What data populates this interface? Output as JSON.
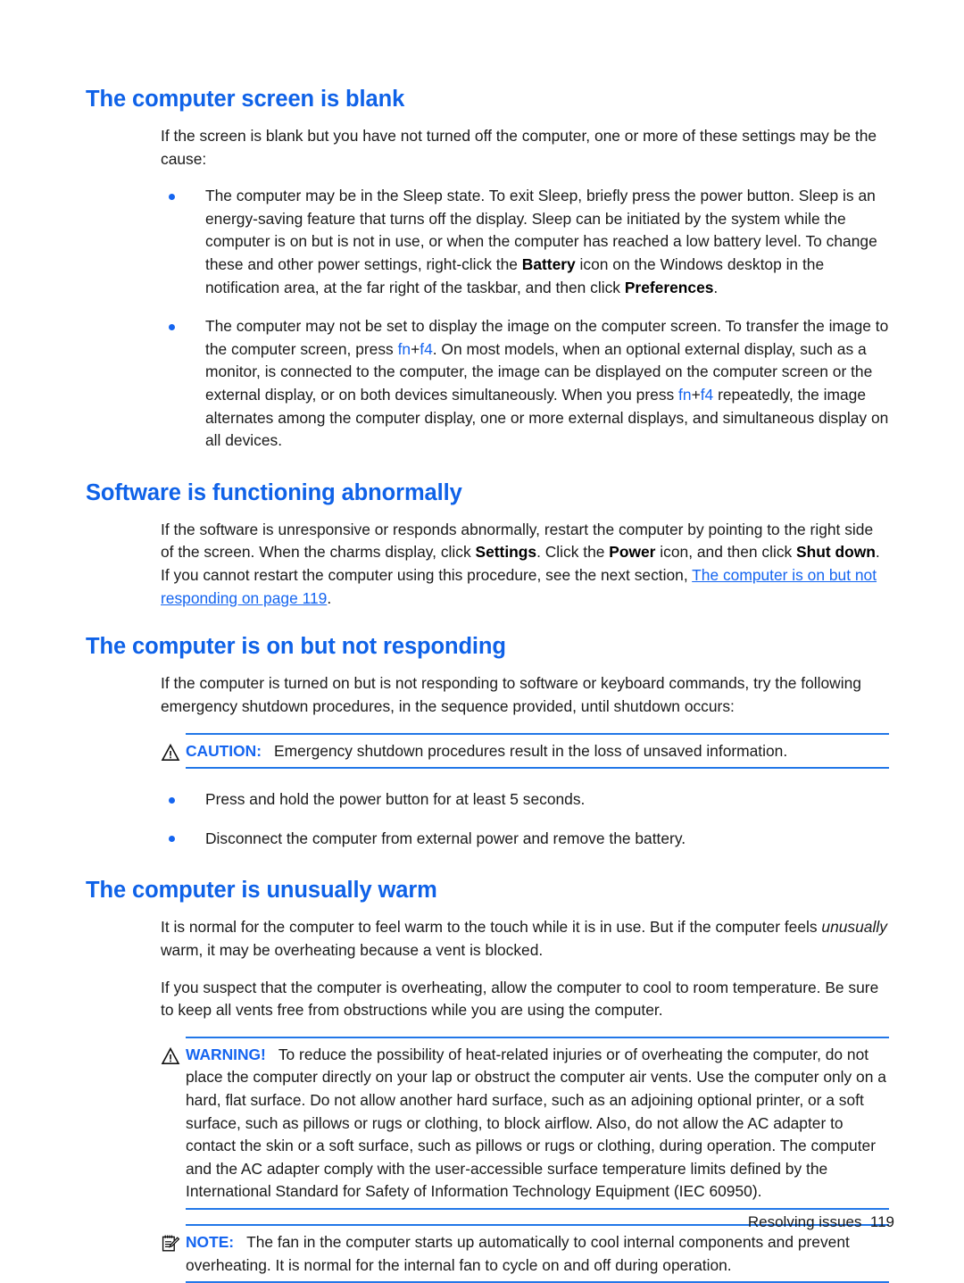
{
  "document": {
    "footer_text": "Resolving issues",
    "footer_page": "119",
    "accent_blue": "#1565f0",
    "rule_blue": "#2277e8"
  },
  "sections": [
    {
      "id": "screen-blank",
      "heading": "The computer screen is blank",
      "intro": "If the screen is blank but you have not turned off the computer, one or more of these settings may be the cause:",
      "bullets": [
        {
          "p1": "The computer may be in the Sleep state. To exit Sleep, briefly press the power button. Sleep is an energy-saving feature that turns off the display. Sleep can be initiated by the system while the computer is on but is not in use, or when the computer has reached a low battery level. To change these and other power settings, right-click the ",
          "b1": "Battery",
          "p2": " icon on the Windows desktop in the notification area, at the far right of the taskbar, and then click ",
          "b2": "Preferences",
          "p3": "."
        },
        {
          "p1": "The computer may not be set to display the image on the computer screen. To transfer the image to the computer screen, press ",
          "k1a": "fn",
          "k1plus": "+",
          "k1b": "f4",
          "p2": ". On most models, when an optional external display, such as a monitor, is connected to the computer, the image can be displayed on the computer screen or the external display, or on both devices simultaneously. When you press ",
          "k2a": "fn",
          "k2plus": "+",
          "k2b": "f4",
          "p3": " repeatedly, the image alternates among the computer display, one or more external displays, and simultaneous display on all devices."
        }
      ]
    },
    {
      "id": "software-abnormal",
      "heading": "Software is functioning abnormally",
      "para": {
        "p1": "If the software is unresponsive or responds abnormally, restart the computer by pointing to the right side of the screen. When the charms display, click ",
        "b1": "Settings",
        "p2": ". Click the ",
        "b2": "Power",
        "p3": " icon, and then click ",
        "b3": "Shut down",
        "p4": ". If you cannot restart the computer using this procedure, see the next section, ",
        "link": "The computer is on but not responding on page 119",
        "p5": "."
      }
    },
    {
      "id": "on-not-responding",
      "heading": "The computer is on but not responding",
      "intro": "If the computer is turned on but is not responding to software or keyboard commands, try the following emergency shutdown procedures, in the sequence provided, until shutdown occurs:",
      "caution": {
        "icon": "warning-triangle-icon",
        "label": "CAUTION:",
        "text": "Emergency shutdown procedures result in the loss of unsaved information."
      },
      "bullets": [
        "Press and hold the power button for at least 5 seconds.",
        "Disconnect the computer from external power and remove the battery."
      ]
    },
    {
      "id": "unusually-warm",
      "heading": "The computer is unusually warm",
      "para1": {
        "p1": "It is normal for the computer to feel warm to the touch while it is in use. But if the computer feels ",
        "i1": "unusually",
        "p2": " warm, it may be overheating because a vent is blocked."
      },
      "para2": "If you suspect that the computer is overheating, allow the computer to cool to room temperature. Be sure to keep all vents free from obstructions while you are using the computer.",
      "warning": {
        "icon": "warning-triangle-icon",
        "label": "WARNING!",
        "text": "To reduce the possibility of heat-related injuries or of overheating the computer, do not place the computer directly on your lap or obstruct the computer air vents. Use the computer only on a hard, flat surface. Do not allow another hard surface, such as an adjoining optional printer, or a soft surface, such as pillows or rugs or clothing, to block airflow. Also, do not allow the AC adapter to contact the skin or a soft surface, such as pillows or rugs or clothing, during operation. The computer and the AC adapter comply with the user-accessible surface temperature limits defined by the International Standard for Safety of Information Technology Equipment (IEC 60950)."
      },
      "note": {
        "icon": "notepad-pencil-icon",
        "label": "NOTE:",
        "text": "The fan in the computer starts up automatically to cool internal components and prevent overheating. It is normal for the internal fan to cycle on and off during operation."
      }
    }
  ]
}
